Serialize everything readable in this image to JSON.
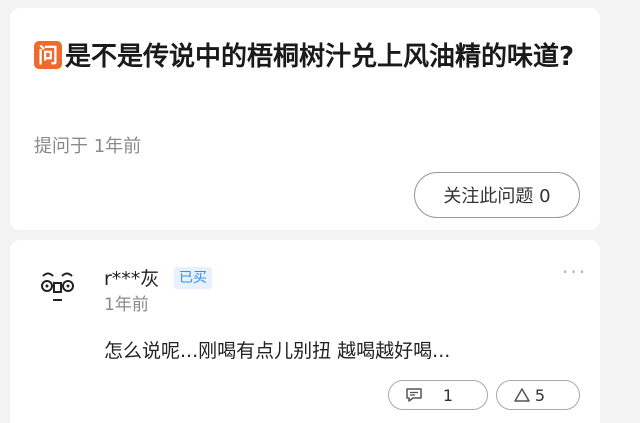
{
  "question": {
    "badge": "问",
    "title": "是不是传说中的梧桐树汁兑上风油精的味道?",
    "meta": "提问于 1年前",
    "follow_label": "关注此问题 0"
  },
  "answer": {
    "username": "r***灰",
    "bought_badge": "已买",
    "time": "1年前",
    "text": "怎么说呢...刚喝有点儿别扭 越喝越好喝...",
    "comment_count": "1",
    "like_count": "5",
    "more_label": "···"
  },
  "icons": {
    "comment": "comment-icon",
    "like": "like-icon",
    "more": "more-icon",
    "avatar": "avatar-face-icon"
  },
  "colors": {
    "ask_badge": "#ee6b2f",
    "bought_badge_bg": "#e6f1fd",
    "bought_badge_text": "#3a8bf0"
  }
}
